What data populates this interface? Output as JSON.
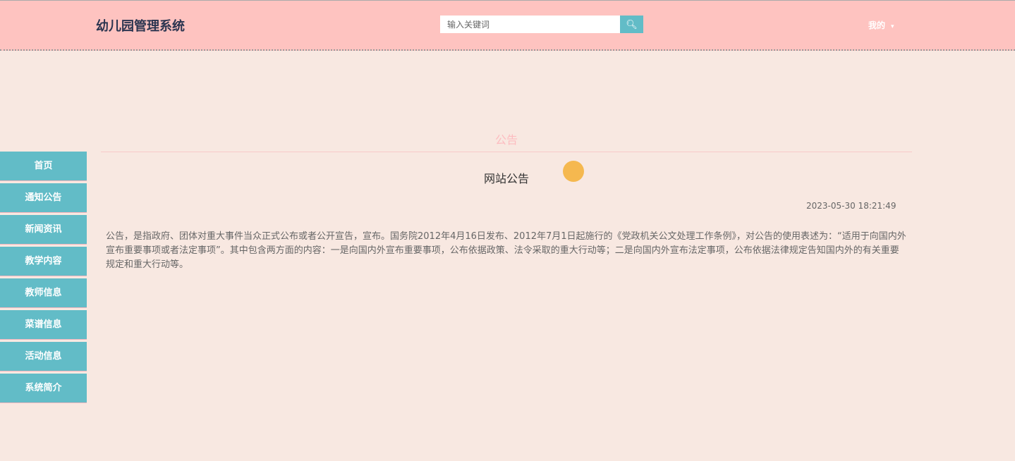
{
  "header": {
    "logo": "幼儿园管理系统",
    "search_placeholder": "输入关键词",
    "search_icon": "search-icon",
    "user_menu": "我的",
    "user_arrow": "▾"
  },
  "sidebar": {
    "items": [
      "首页",
      "通知公告",
      "新闻资讯",
      "教学内容",
      "教师信息",
      "菜谱信息",
      "活动信息",
      "系统简介"
    ]
  },
  "main": {
    "section_title": "公告",
    "article_title": "网站公告",
    "date": "2023-05-30 18:21:49",
    "content": "公告，是指政府、团体对重大事件当众正式公布或者公开宣告，宣布。国务院2012年4月16日发布、2012年7月1日起施行的《党政机关公文处理工作条例》，对公告的使用表述为：“适用于向国内外宣布重要事项或者法定事项”。其中包含两方面的内容：一是向国内外宣布重要事项，公布依据政策、法令采取的重大行动等；二是向国内外宣布法定事项，公布依据法律规定告知国内外的有关重要规定和重大行动等。"
  }
}
